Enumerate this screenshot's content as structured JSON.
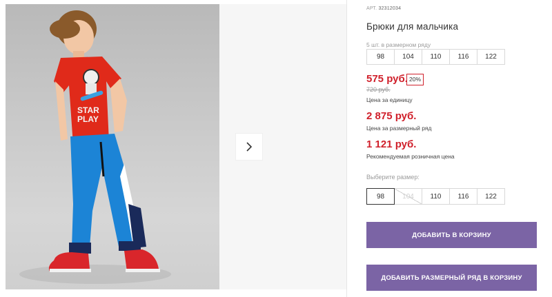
{
  "product": {
    "article_label": "АРТ.",
    "article": "32312034",
    "title": "Брюки для мальчика",
    "row_caption": "5 шт. в размерном ряду",
    "row_sizes": [
      "98",
      "104",
      "110",
      "116",
      "122"
    ]
  },
  "pricing": {
    "price": "575 руб.",
    "discount": "20%",
    "old_price": "720 руб.",
    "unit_label": "Цена за единицу",
    "row_price": "2 875 руб.",
    "row_label": "Цена за размерный ряд",
    "retail_price": "1 121 руб.",
    "retail_label": "Рекомендуемая розничная цена"
  },
  "size_select": {
    "label": "Выберите размер:",
    "options": [
      "98",
      "104",
      "110",
      "116",
      "122"
    ],
    "selected": "98",
    "unavailable": [
      "104"
    ]
  },
  "actions": {
    "add_to_cart": "ДОБАВИТЬ В КОРЗИНУ",
    "add_row_to_cart": "ДОБАВИТЬ РАЗМЕРНЫЙ РЯД В КОРЗИНУ"
  },
  "gallery": {
    "next_icon": "chevron-right-icon",
    "shirt_print": "STAR PLAY"
  },
  "colors": {
    "accent": "#7b64a5",
    "price": "#d0202b"
  }
}
